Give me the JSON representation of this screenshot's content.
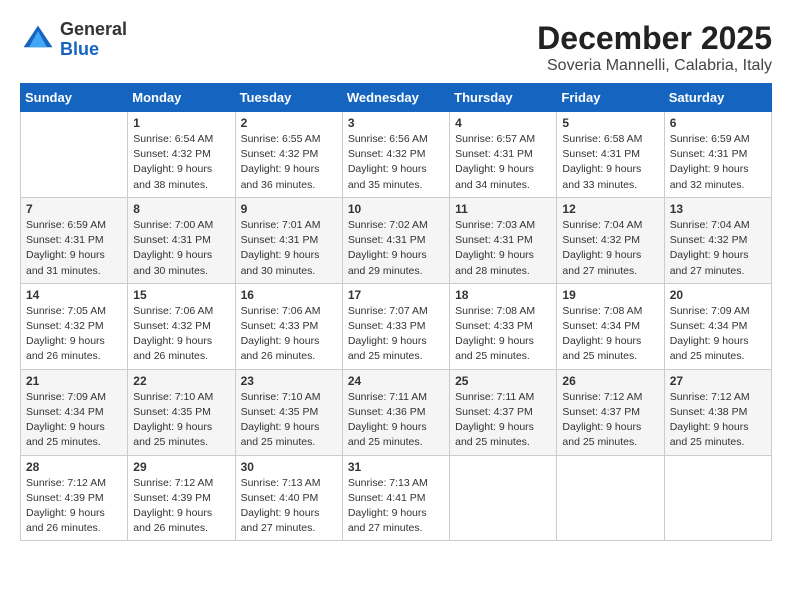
{
  "logo": {
    "general": "General",
    "blue": "Blue"
  },
  "title": "December 2025",
  "subtitle": "Soveria Mannelli, Calabria, Italy",
  "weekdays": [
    "Sunday",
    "Monday",
    "Tuesday",
    "Wednesday",
    "Thursday",
    "Friday",
    "Saturday"
  ],
  "weeks": [
    [
      {
        "day": "",
        "info": ""
      },
      {
        "day": "1",
        "info": "Sunrise: 6:54 AM\nSunset: 4:32 PM\nDaylight: 9 hours\nand 38 minutes."
      },
      {
        "day": "2",
        "info": "Sunrise: 6:55 AM\nSunset: 4:32 PM\nDaylight: 9 hours\nand 36 minutes."
      },
      {
        "day": "3",
        "info": "Sunrise: 6:56 AM\nSunset: 4:32 PM\nDaylight: 9 hours\nand 35 minutes."
      },
      {
        "day": "4",
        "info": "Sunrise: 6:57 AM\nSunset: 4:31 PM\nDaylight: 9 hours\nand 34 minutes."
      },
      {
        "day": "5",
        "info": "Sunrise: 6:58 AM\nSunset: 4:31 PM\nDaylight: 9 hours\nand 33 minutes."
      },
      {
        "day": "6",
        "info": "Sunrise: 6:59 AM\nSunset: 4:31 PM\nDaylight: 9 hours\nand 32 minutes."
      }
    ],
    [
      {
        "day": "7",
        "info": "Sunrise: 6:59 AM\nSunset: 4:31 PM\nDaylight: 9 hours\nand 31 minutes."
      },
      {
        "day": "8",
        "info": "Sunrise: 7:00 AM\nSunset: 4:31 PM\nDaylight: 9 hours\nand 30 minutes."
      },
      {
        "day": "9",
        "info": "Sunrise: 7:01 AM\nSunset: 4:31 PM\nDaylight: 9 hours\nand 30 minutes."
      },
      {
        "day": "10",
        "info": "Sunrise: 7:02 AM\nSunset: 4:31 PM\nDaylight: 9 hours\nand 29 minutes."
      },
      {
        "day": "11",
        "info": "Sunrise: 7:03 AM\nSunset: 4:31 PM\nDaylight: 9 hours\nand 28 minutes."
      },
      {
        "day": "12",
        "info": "Sunrise: 7:04 AM\nSunset: 4:32 PM\nDaylight: 9 hours\nand 27 minutes."
      },
      {
        "day": "13",
        "info": "Sunrise: 7:04 AM\nSunset: 4:32 PM\nDaylight: 9 hours\nand 27 minutes."
      }
    ],
    [
      {
        "day": "14",
        "info": "Sunrise: 7:05 AM\nSunset: 4:32 PM\nDaylight: 9 hours\nand 26 minutes."
      },
      {
        "day": "15",
        "info": "Sunrise: 7:06 AM\nSunset: 4:32 PM\nDaylight: 9 hours\nand 26 minutes."
      },
      {
        "day": "16",
        "info": "Sunrise: 7:06 AM\nSunset: 4:33 PM\nDaylight: 9 hours\nand 26 minutes."
      },
      {
        "day": "17",
        "info": "Sunrise: 7:07 AM\nSunset: 4:33 PM\nDaylight: 9 hours\nand 25 minutes."
      },
      {
        "day": "18",
        "info": "Sunrise: 7:08 AM\nSunset: 4:33 PM\nDaylight: 9 hours\nand 25 minutes."
      },
      {
        "day": "19",
        "info": "Sunrise: 7:08 AM\nSunset: 4:34 PM\nDaylight: 9 hours\nand 25 minutes."
      },
      {
        "day": "20",
        "info": "Sunrise: 7:09 AM\nSunset: 4:34 PM\nDaylight: 9 hours\nand 25 minutes."
      }
    ],
    [
      {
        "day": "21",
        "info": "Sunrise: 7:09 AM\nSunset: 4:34 PM\nDaylight: 9 hours\nand 25 minutes."
      },
      {
        "day": "22",
        "info": "Sunrise: 7:10 AM\nSunset: 4:35 PM\nDaylight: 9 hours\nand 25 minutes."
      },
      {
        "day": "23",
        "info": "Sunrise: 7:10 AM\nSunset: 4:35 PM\nDaylight: 9 hours\nand 25 minutes."
      },
      {
        "day": "24",
        "info": "Sunrise: 7:11 AM\nSunset: 4:36 PM\nDaylight: 9 hours\nand 25 minutes."
      },
      {
        "day": "25",
        "info": "Sunrise: 7:11 AM\nSunset: 4:37 PM\nDaylight: 9 hours\nand 25 minutes."
      },
      {
        "day": "26",
        "info": "Sunrise: 7:12 AM\nSunset: 4:37 PM\nDaylight: 9 hours\nand 25 minutes."
      },
      {
        "day": "27",
        "info": "Sunrise: 7:12 AM\nSunset: 4:38 PM\nDaylight: 9 hours\nand 25 minutes."
      }
    ],
    [
      {
        "day": "28",
        "info": "Sunrise: 7:12 AM\nSunset: 4:39 PM\nDaylight: 9 hours\nand 26 minutes."
      },
      {
        "day": "29",
        "info": "Sunrise: 7:12 AM\nSunset: 4:39 PM\nDaylight: 9 hours\nand 26 minutes."
      },
      {
        "day": "30",
        "info": "Sunrise: 7:13 AM\nSunset: 4:40 PM\nDaylight: 9 hours\nand 27 minutes."
      },
      {
        "day": "31",
        "info": "Sunrise: 7:13 AM\nSunset: 4:41 PM\nDaylight: 9 hours\nand 27 minutes."
      },
      {
        "day": "",
        "info": ""
      },
      {
        "day": "",
        "info": ""
      },
      {
        "day": "",
        "info": ""
      }
    ]
  ]
}
